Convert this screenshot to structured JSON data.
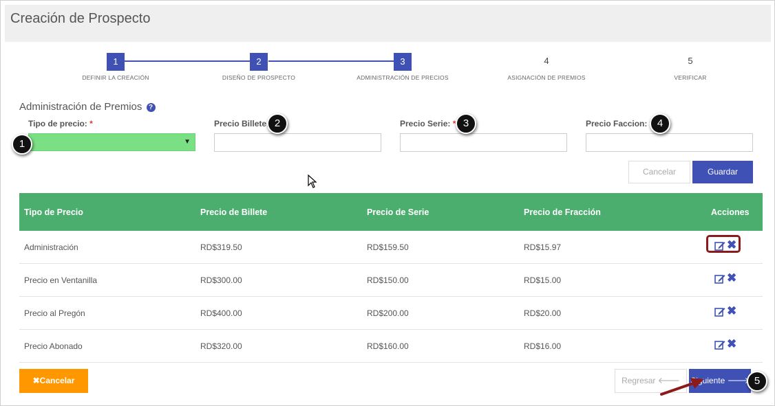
{
  "page": {
    "title": "Creación de Prospecto"
  },
  "wizard": {
    "steps": [
      {
        "number": "1",
        "label": "DEFINIR LA CREACIÓN"
      },
      {
        "number": "2",
        "label": "DISEÑO DE PROSPECTO"
      },
      {
        "number": "3",
        "label": "ADMINISTRACIÓN DE PRECIOS"
      },
      {
        "number": "4",
        "label": "ASIGNACIÓN DE PREMIOS"
      },
      {
        "number": "5",
        "label": "VERIFICAR"
      }
    ]
  },
  "section": {
    "title": "Administración de Premios",
    "help_icon": "?"
  },
  "form": {
    "tipo_precio_label": "Tipo de precio:",
    "precio_billete_label": "Precio Billete:",
    "precio_serie_label": "Precio Serie:",
    "precio_faccion_label": "Precio Faccion:",
    "required_mark": "*",
    "select_arrow": "▼",
    "cancel_label": "Cancelar",
    "save_label": "Guardar"
  },
  "table": {
    "headers": [
      "Tipo de Precio",
      "Precio de Billete",
      "Precio de Serie",
      "Precio de Fracción",
      "Acciones"
    ],
    "rows": [
      {
        "tipo": "Administración",
        "billete": "RD$319.50",
        "serie": "RD$159.50",
        "fraccion": "RD$15.97"
      },
      {
        "tipo": "Precio en Ventanilla",
        "billete": "RD$300.00",
        "serie": "RD$150.00",
        "fraccion": "RD$15.00"
      },
      {
        "tipo": "Precio al Pregón",
        "billete": "RD$400.00",
        "serie": "RD$200.00",
        "fraccion": "RD$20.00"
      },
      {
        "tipo": "Precio Abonado",
        "billete": "RD$320.00",
        "serie": "RD$160.00",
        "fraccion": "RD$16.00"
      }
    ],
    "delete_glyph": "✖"
  },
  "footer": {
    "cancel_label": "✖Cancelar",
    "back_label": "Regresar 🡐",
    "next_label": "Siguiente 🡒"
  },
  "callouts": [
    "1",
    "2",
    "3",
    "4",
    "5"
  ],
  "colors": {
    "primary": "#3f51b5",
    "table_header": "#4cae6e",
    "select_fill": "#7be083",
    "warning": "#ff9800",
    "highlight_border": "#8b1a1a"
  }
}
